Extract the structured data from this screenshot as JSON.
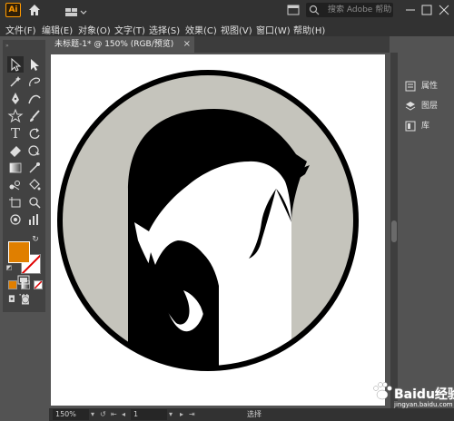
{
  "app": {
    "logo_text": "Ai",
    "search_placeholder": "搜索 Adobe 帮助"
  },
  "menu": {
    "items": [
      "文件(F)",
      "编辑(E)",
      "对象(O)",
      "文字(T)",
      "选择(S)",
      "效果(C)",
      "视图(V)",
      "窗口(W)",
      "帮助(H)"
    ]
  },
  "document": {
    "tab_title": "未标题-1* @ 150% (RGB/预览)",
    "tab_close": "×"
  },
  "swatches": {
    "fill_color": "#e07f00",
    "stroke": "none"
  },
  "artwork": {
    "circle_outline": "#000000",
    "background_gray": "#c5c4bc",
    "horse_dark": "#000000",
    "horse_light": "#ffffff"
  },
  "right_panel": {
    "items": [
      "属性",
      "图层",
      "库"
    ]
  },
  "status": {
    "zoom": "150%",
    "artboard_number": "1",
    "tool_name": "选择"
  },
  "watermark": {
    "text": "Baidu经验",
    "sub": "jingyan.baidu.com"
  }
}
